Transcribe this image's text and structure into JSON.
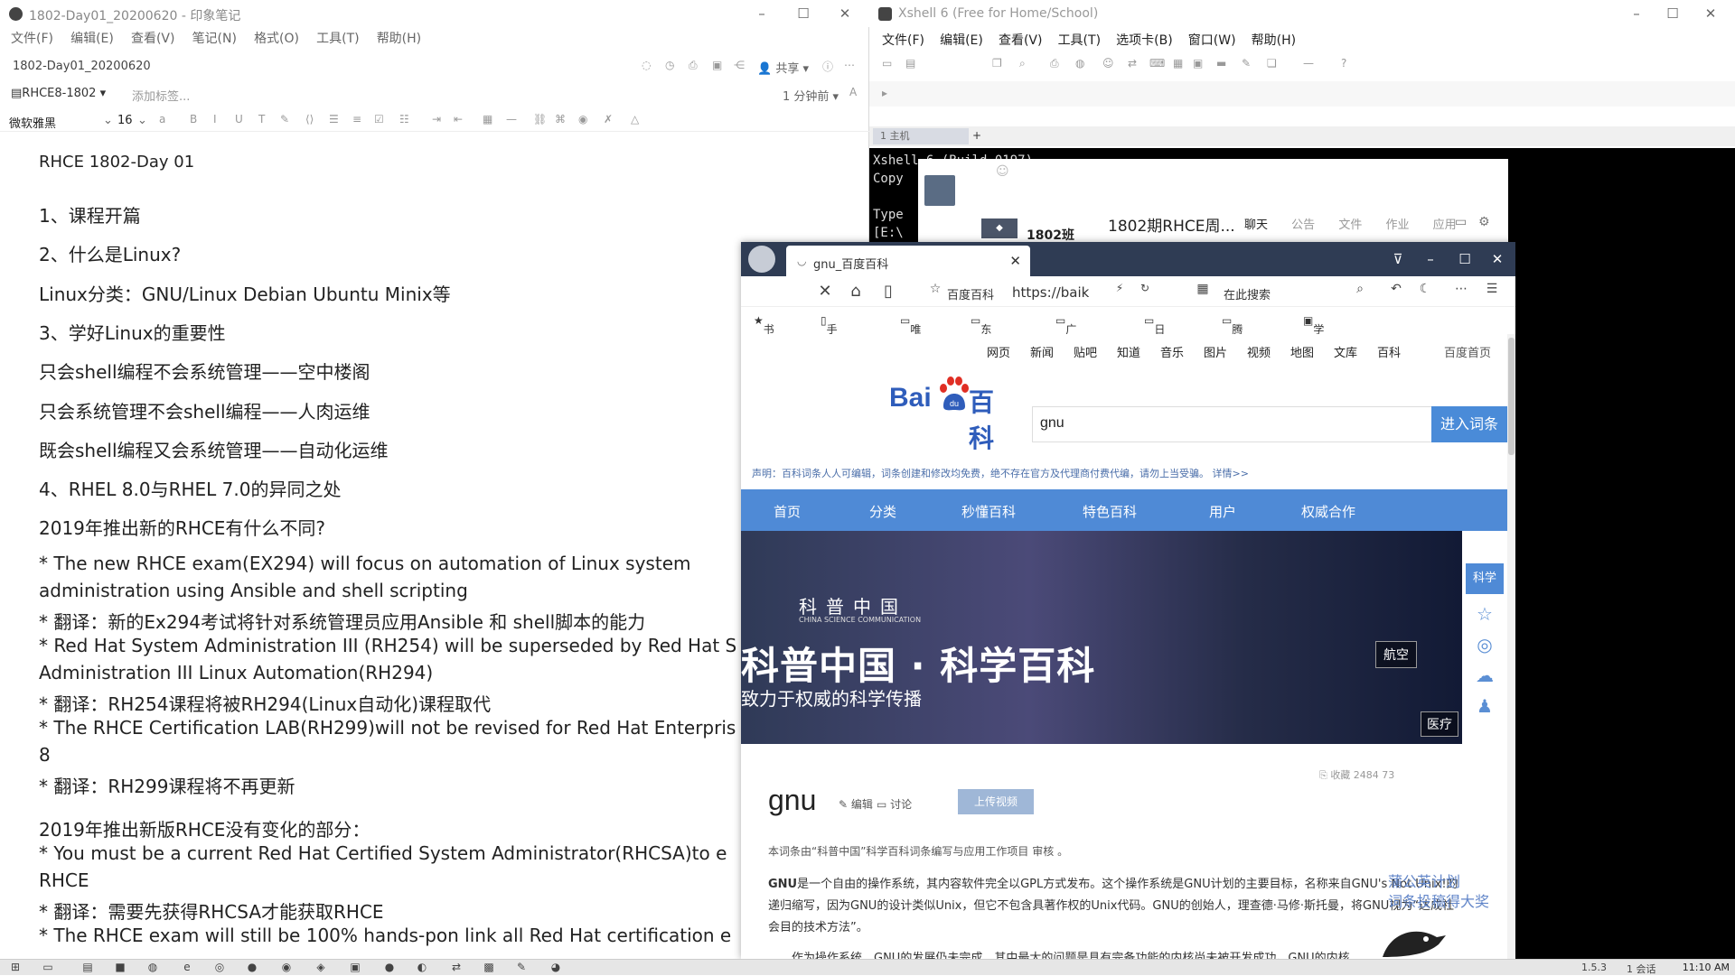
{
  "note": {
    "window_title": "1802-Day01_20200620 - 印象笔记",
    "menu": [
      "文件(F)",
      "编辑(E)",
      "查看(V)",
      "笔记(N)",
      "格式(O)",
      "工具(T)",
      "帮助(H)"
    ],
    "doc_name": "1802-Day01_20200620",
    "share_label": "共享",
    "notebook": "RHCE8-1802",
    "add_tag": "添加标签...",
    "time_ago": "1 分钟前",
    "font_name": "微软雅黑",
    "font_size": "16",
    "lines": [
      "RHCE 1802-Day 01",
      "1、课程开篇",
      "2、什么是Linux?",
      "Linux分类：GNU/Linux Debian Ubuntu Minix等",
      "3、学好Linux的重要性",
      "只会shell编程不会系统管理——空中楼阁",
      "只会系统管理不会shell编程——人肉运维",
      "既会shell编程又会系统管理——自动化运维",
      "4、RHEL 8.0与RHEL 7.0的异同之处",
      "2019年推出新的RHCE有什么不同?",
      "* The new RHCE exam(EX294) will focus on automation of Linux system",
      "administration using Ansible and shell scripting",
      "* 翻译：新的Ex294考试将针对系统管理员应用Ansible 和 shell脚本的能力",
      "* Red Hat System Administration III (RH254) will be superseded by Red Hat S",
      "Administration III Linux Automation(RH294)",
      "* 翻译：RH254课程将被RH294(Linux自动化)课程取代",
      "* The RHCE Certification LAB(RH299)will not be revised for Red Hat Enterpris",
      "8",
      "* 翻译：RH299课程将不再更新",
      "2019年推出新版RHCE没有变化的部分：",
      "* You must be a current Red Hat Certified System Administrator(RHCSA)to e",
      "RHCE",
      "* 翻译：需要先获得RHCSA才能获取RHCE",
      "* The RHCE exam will still be 100% hands-pon link all Red Hat certification e"
    ]
  },
  "xshell": {
    "window_title": "Xshell 6 (Free for Home/School)",
    "menu": [
      "文件(F)",
      "编辑(E)",
      "查看(V)",
      "工具(T)",
      "选项卡(B)",
      "窗口(W)",
      "帮助(H)"
    ],
    "tab_label": "1 主机",
    "terminal_lines": [
      "Xshell 6 (Build 0197)",
      "Copy",
      "",
      "Type",
      "[E:\\"
    ]
  },
  "qq": {
    "group_short": "1802班",
    "group_name": "1802期RHCE周...",
    "tabs": [
      "聊天",
      "公告",
      "文件",
      "作业",
      "应用"
    ]
  },
  "browser": {
    "tab_title": "gnu_百度百科",
    "site_label": "百度百科",
    "url": "https://baik",
    "search_placeholder": "在此搜索",
    "bookmarks": [
      "书签",
      "手机书签",
      "唯品会",
      "东方思维",
      "广州地铁",
      "日常生活",
      "腾科培训",
      "学习强国"
    ]
  },
  "baike": {
    "topnav": [
      "网页",
      "新闻",
      "贴吧",
      "知道",
      "音乐",
      "图片",
      "视频",
      "地图",
      "文库",
      "百科"
    ],
    "home_link": "百度首页",
    "logo_bai": "Bai",
    "logo_ke": "百科",
    "search_value": "gnu",
    "search_button": "进入词条",
    "notice": "声明：百科词条人人可编辑，词条创建和修改均免费，绝不存在官方及代理商付费代编，请勿上当受骗。 详情>>",
    "mainnav": [
      "首页",
      "分类",
      "秒懂百科",
      "特色百科",
      "用户",
      "权威合作"
    ],
    "banner_org": "科普中国",
    "banner_org_sub": "CHINA SCIENCE COMMUNICATION",
    "banner_headline": "科普中国 · 科学百科",
    "banner_sub": "致力于权威的科学传播",
    "hotspot_1": "航空",
    "hotspot_2": "医疗",
    "sidebar_science": "科学",
    "actions": "收藏  2484  73",
    "title": "gnu",
    "edit": "编辑",
    "discuss": "讨论",
    "upload": "上传视频",
    "source": "本词条由“科普中国”科学百科词条编写与应用工作项目 审核 。",
    "para1_bold": "GNU",
    "para1": "是一个自由的操作系统，其内容软件完全以GPL方式发布。这个操作系统是GNU计划的主要目标，名称来自GNU's Not Unix!的递归缩写，因为GNU的设计类似Unix，但它不包含具著作权的Unix代码。GNU的创始人，理查德·马修·斯托曼，将GNU视为“达成社会目的技术方法”。",
    "para2": "作为操作系统，GNU的发展仍未完成，其中最大的问题是具有完备功能的内核尚未被开发成功。GNU的内核，",
    "promo_1": "蒲公英计划",
    "promo_2": "词条投稿得大奖"
  },
  "taskbar": {
    "clock": "11:10 AM",
    "tray_1": "1.5.3",
    "tray_2": "1 会话"
  }
}
